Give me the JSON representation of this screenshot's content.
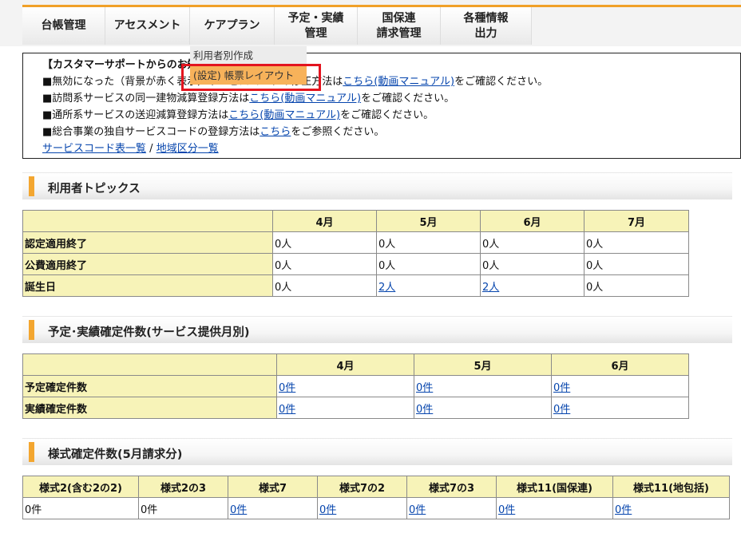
{
  "nav": {
    "items": [
      {
        "label": "台帳管理",
        "label2": ""
      },
      {
        "label": "アセスメント",
        "label2": ""
      },
      {
        "label": "ケアプラン",
        "label2": ""
      },
      {
        "label": "予定・実績",
        "label2": "管理"
      },
      {
        "label": "国保連",
        "label2": "請求管理"
      },
      {
        "label": "各種情報",
        "label2": "出力"
      }
    ],
    "dropdown": [
      "利用者別作成",
      "(設定) 帳票レイアウト"
    ]
  },
  "notice": {
    "title": "【カスタマーサポートからのお知らせ】",
    "line1_pre": "■無効になった（背景が赤く表示）サービスコードの修正方法は",
    "line1_link": "こちら(動画マニュアル)",
    "line1_post": "をご確認ください。",
    "line2_pre": "■訪問系サービスの同一建物減算登録方法は",
    "line2_link": "こちら(動画マニュアル)",
    "line2_post": "をご確認ください。",
    "line3_pre": "■通所系サービスの送迎減算登録方法は",
    "line3_link": "こちら(動画マニュアル)",
    "line3_post": "をご確認ください。",
    "line4_pre": "■総合事業の独自サービスコードの登録方法は",
    "line4_link": "こちら",
    "line4_post": "をご参照ください。",
    "link_service_codes": "サービスコード表一覧",
    "separator": "/",
    "link_area": "地域区分一覧"
  },
  "topics": {
    "title": "利用者トピックス",
    "months": [
      "4月",
      "5月",
      "6月",
      "7月"
    ],
    "rows": [
      {
        "label": "認定適用終了",
        "values": [
          "0人",
          "0人",
          "0人",
          "0人"
        ]
      },
      {
        "label": "公費適用終了",
        "values": [
          "0人",
          "0人",
          "0人",
          "0人"
        ]
      },
      {
        "label": "誕生日",
        "values": [
          "0人",
          "2人",
          "2人",
          "0人"
        ]
      }
    ]
  },
  "confirm": {
    "title": "予定･実績確定件数(サービス提供月別)",
    "months": [
      "4月",
      "5月",
      "6月"
    ],
    "rows": [
      {
        "label": "予定確定件数",
        "values": [
          "0件",
          "0件",
          "0件"
        ]
      },
      {
        "label": "実績確定件数",
        "values": [
          "0件",
          "0件",
          "0件"
        ]
      }
    ]
  },
  "forms": {
    "title": "様式確定件数(5月請求分)",
    "headers": [
      "様式2(含む2の2)",
      "様式2の3",
      "様式7",
      "様式7の2",
      "様式7の3",
      "様式11(国保連)",
      "様式11(地包括)"
    ],
    "values": [
      "0件",
      "0件",
      "0件",
      "0件",
      "0件",
      "0件",
      "0件"
    ]
  }
}
